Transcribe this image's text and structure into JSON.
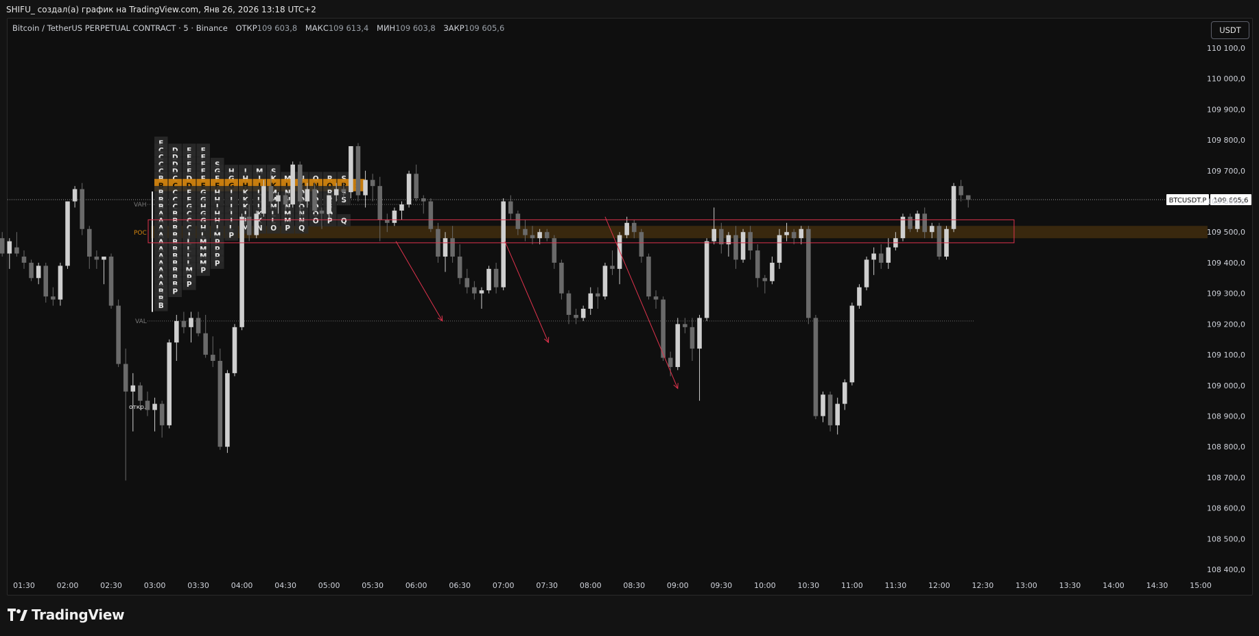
{
  "caption": "SHIFU_ создал(а) график на TradingView.com, Янв 26, 2026 13:18 UTC+2",
  "legend": {
    "symbol": "Bitcoin / TetherUS PERPETUAL CONTRACT · 5 · Binance",
    "open_label": "ОТКР",
    "open": "109 603,8",
    "high_label": "МАКС",
    "high": "109 613,4",
    "low_label": "МИН",
    "low": "109 603,8",
    "close_label": "ЗАКР",
    "close": "109 605,6"
  },
  "currency_button": "USDT",
  "brand": "TradingView",
  "chart_data": {
    "type": "candlestick",
    "symbol": "BTCUSDT.P",
    "interval": "5",
    "last_price_label": "BTCUSDT.P",
    "last_price_text": "109 605,6",
    "last_price": 109605.6,
    "ylim": [
      108390,
      110125
    ],
    "y_ticks": [
      110100,
      110000,
      109900,
      109800,
      109700,
      109600,
      109500,
      109400,
      109300,
      109200,
      109100,
      109000,
      108900,
      108800,
      108700,
      108600,
      108500,
      108400
    ],
    "y_tick_labels": [
      "110 100,0",
      "110 000,0",
      "109 900,0",
      "109 800,0",
      "109 700,0",
      "109 600,0",
      "109 500,0",
      "109 400,0",
      "109 300,0",
      "109 200,0",
      "109 100,0",
      "109 000,0",
      "108 900,0",
      "108 800,0",
      "108 700,0",
      "108 600,0",
      "108 500,0",
      "108 400,0"
    ],
    "x_tick_labels": [
      "01:30",
      "02:00",
      "02:30",
      "03:00",
      "03:30",
      "04:00",
      "04:30",
      "05:00",
      "05:30",
      "06:00",
      "06:30",
      "07:00",
      "07:30",
      "08:00",
      "08:30",
      "09:00",
      "09:30",
      "10:00",
      "10:30",
      "11:00",
      "11:30",
      "12:00",
      "12:30",
      "13:00",
      "13:30",
      "14:00",
      "14:30",
      "15:00"
    ],
    "x_tick_minutes": [
      90,
      120,
      150,
      180,
      210,
      240,
      270,
      300,
      330,
      360,
      390,
      420,
      450,
      480,
      510,
      540,
      570,
      600,
      630,
      660,
      690,
      720,
      750,
      780,
      810,
      840,
      870,
      900
    ],
    "xlim_minutes": [
      75,
      904
    ],
    "candles_start_minute": 75,
    "candles_interval_minutes": 5,
    "candles": [
      [
        109480,
        109500,
        109420,
        109430
      ],
      [
        109430,
        109480,
        109380,
        109470
      ],
      [
        109450,
        109500,
        109420,
        109430
      ],
      [
        109420,
        109440,
        109380,
        109400
      ],
      [
        109400,
        109410,
        109340,
        109350
      ],
      [
        109350,
        109400,
        109330,
        109390
      ],
      [
        109390,
        109400,
        109270,
        109290
      ],
      [
        109290,
        109320,
        109260,
        109280
      ],
      [
        109280,
        109400,
        109260,
        109390
      ],
      [
        109390,
        109600,
        109380,
        109600
      ],
      [
        109600,
        109650,
        109580,
        109640
      ],
      [
        109640,
        109660,
        109490,
        109510
      ],
      [
        109510,
        109520,
        109380,
        109420
      ],
      [
        109420,
        109440,
        109380,
        109410
      ],
      [
        109410,
        109420,
        109330,
        109420
      ],
      [
        109420,
        109430,
        109250,
        109260
      ],
      [
        109260,
        109280,
        109060,
        109070
      ],
      [
        109070,
        109120,
        108690,
        108980
      ],
      [
        108980,
        109040,
        108850,
        109000
      ],
      [
        109000,
        109010,
        108920,
        108950
      ],
      [
        108950,
        108980,
        108900,
        108920
      ],
      [
        108920,
        108960,
        108850,
        108940
      ],
      [
        108940,
        108950,
        108830,
        108870
      ],
      [
        108870,
        109150,
        108860,
        109140
      ],
      [
        109140,
        109230,
        109080,
        109210
      ],
      [
        109210,
        109240,
        109170,
        109190
      ],
      [
        109190,
        109240,
        109140,
        109220
      ],
      [
        109220,
        109240,
        109160,
        109170
      ],
      [
        109170,
        109230,
        109090,
        109100
      ],
      [
        109100,
        109160,
        109060,
        109080
      ],
      [
        109080,
        109120,
        108790,
        108800
      ],
      [
        108800,
        109050,
        108780,
        109040
      ],
      [
        109040,
        109200,
        109030,
        109190
      ],
      [
        109190,
        109560,
        109180,
        109550
      ],
      [
        109550,
        109590,
        109470,
        109490
      ],
      [
        109490,
        109570,
        109480,
        109560
      ],
      [
        109560,
        109670,
        109550,
        109650
      ],
      [
        109650,
        109700,
        109580,
        109600
      ],
      [
        109600,
        109630,
        109560,
        109620
      ],
      [
        109620,
        109630,
        109570,
        109590
      ],
      [
        109590,
        109730,
        109580,
        109720
      ],
      [
        109720,
        109730,
        109550,
        109600
      ],
      [
        109600,
        109660,
        109580,
        109640
      ],
      [
        109640,
        109660,
        109560,
        109570
      ],
      [
        109570,
        109580,
        109510,
        109560
      ],
      [
        109560,
        109620,
        109530,
        109620
      ],
      [
        109620,
        109660,
        109600,
        109640
      ],
      [
        109640,
        109660,
        109600,
        109630
      ],
      [
        109630,
        109780,
        109610,
        109780
      ],
      [
        109780,
        109790,
        109600,
        109620
      ],
      [
        109620,
        109700,
        109580,
        109670
      ],
      [
        109670,
        109690,
        109600,
        109650
      ],
      [
        109650,
        109680,
        109470,
        109540
      ],
      [
        109540,
        109560,
        109500,
        109530
      ],
      [
        109530,
        109580,
        109520,
        109570
      ],
      [
        109570,
        109600,
        109540,
        109590
      ],
      [
        109590,
        109700,
        109580,
        109690
      ],
      [
        109690,
        109720,
        109600,
        109610
      ],
      [
        109610,
        109620,
        109560,
        109600
      ],
      [
        109600,
        109610,
        109500,
        109510
      ],
      [
        109510,
        109530,
        109400,
        109420
      ],
      [
        109420,
        109500,
        109370,
        109480
      ],
      [
        109480,
        109520,
        109400,
        109420
      ],
      [
        109420,
        109460,
        109330,
        109350
      ],
      [
        109350,
        109380,
        109300,
        109320
      ],
      [
        109320,
        109340,
        109280,
        109300
      ],
      [
        109300,
        109320,
        109250,
        109310
      ],
      [
        109310,
        109390,
        109300,
        109380
      ],
      [
        109380,
        109400,
        109300,
        109320
      ],
      [
        109320,
        109610,
        109310,
        109600
      ],
      [
        109600,
        109620,
        109540,
        109560
      ],
      [
        109560,
        109570,
        109490,
        109510
      ],
      [
        109510,
        109540,
        109470,
        109490
      ],
      [
        109490,
        109520,
        109460,
        109480
      ],
      [
        109480,
        109510,
        109460,
        109500
      ],
      [
        109500,
        109510,
        109470,
        109480
      ],
      [
        109480,
        109490,
        109380,
        109400
      ],
      [
        109400,
        109410,
        109280,
        109300
      ],
      [
        109300,
        109310,
        109200,
        109230
      ],
      [
        109230,
        109250,
        109200,
        109220
      ],
      [
        109220,
        109260,
        109210,
        109250
      ],
      [
        109250,
        109320,
        109230,
        109300
      ],
      [
        109300,
        109320,
        109250,
        109290
      ],
      [
        109290,
        109400,
        109280,
        109390
      ],
      [
        109390,
        109440,
        109360,
        109380
      ],
      [
        109380,
        109500,
        109330,
        109490
      ],
      [
        109490,
        109550,
        109480,
        109530
      ],
      [
        109530,
        109540,
        109480,
        109500
      ],
      [
        109500,
        109510,
        109400,
        109420
      ],
      [
        109420,
        109430,
        109280,
        109290
      ],
      [
        109290,
        109310,
        109250,
        109280
      ],
      [
        109280,
        109290,
        109080,
        109090
      ],
      [
        109090,
        109110,
        109030,
        109060
      ],
      [
        109060,
        109220,
        109050,
        109200
      ],
      [
        109200,
        109220,
        109170,
        109190
      ],
      [
        109190,
        109220,
        109080,
        109120
      ],
      [
        109120,
        109230,
        108950,
        109220
      ],
      [
        109220,
        109480,
        109210,
        109470
      ],
      [
        109470,
        109580,
        109460,
        109510
      ],
      [
        109510,
        109530,
        109430,
        109460
      ],
      [
        109460,
        109500,
        109420,
        109490
      ],
      [
        109490,
        109520,
        109380,
        109410
      ],
      [
        109410,
        109510,
        109400,
        109500
      ],
      [
        109500,
        109520,
        109410,
        109440
      ],
      [
        109440,
        109460,
        109320,
        109350
      ],
      [
        109350,
        109360,
        109300,
        109340
      ],
      [
        109340,
        109420,
        109330,
        109400
      ],
      [
        109400,
        109510,
        109380,
        109490
      ],
      [
        109490,
        109530,
        109470,
        109500
      ],
      [
        109500,
        109510,
        109460,
        109480
      ],
      [
        109480,
        109520,
        109460,
        109510
      ],
      [
        109510,
        109520,
        109200,
        109220
      ],
      [
        109220,
        109230,
        108890,
        108900
      ],
      [
        108900,
        108980,
        108880,
        108970
      ],
      [
        108970,
        108980,
        108850,
        108870
      ],
      [
        108870,
        108960,
        108840,
        108940
      ],
      [
        108940,
        109020,
        108920,
        109010
      ],
      [
        109010,
        109270,
        109000,
        109260
      ],
      [
        109260,
        109330,
        109250,
        109320
      ],
      [
        109320,
        109420,
        109310,
        109410
      ],
      [
        109410,
        109450,
        109360,
        109430
      ],
      [
        109430,
        109460,
        109380,
        109400
      ],
      [
        109400,
        109480,
        109380,
        109450
      ],
      [
        109450,
        109500,
        109440,
        109480
      ],
      [
        109480,
        109560,
        109470,
        109550
      ],
      [
        109550,
        109560,
        109500,
        109510
      ],
      [
        109510,
        109570,
        109500,
        109560
      ],
      [
        109560,
        109580,
        109480,
        109500
      ],
      [
        109500,
        109530,
        109480,
        109520
      ],
      [
        109520,
        109530,
        109410,
        109420
      ],
      [
        109420,
        109520,
        109410,
        109510
      ],
      [
        109510,
        109660,
        109500,
        109650
      ],
      [
        109650,
        109670,
        109600,
        109620
      ],
      [
        109620,
        109610,
        109580,
        109606
      ]
    ],
    "tpo_profile": {
      "poc_label": "POC",
      "vah_label": "VAH",
      "val_label": "VAL",
      "open_marker_label": "откр.",
      "poc_price": 109500,
      "vah_price": 109590,
      "val_price": 109210,
      "row_start_price": 109790,
      "row_step": 23,
      "rows": [
        [
          "E"
        ],
        [
          "C",
          "D",
          "E",
          "F"
        ],
        [
          "C",
          "D",
          "E",
          "F"
        ],
        [
          "C",
          "D",
          "E",
          "F",
          "S"
        ],
        [
          "C",
          "D",
          "E",
          "F",
          "G",
          "H",
          "I",
          "M",
          "S"
        ],
        [
          "B",
          "C",
          "D",
          "E",
          "F",
          "G",
          "H",
          "I",
          "K",
          "M",
          "N",
          "O",
          "R",
          "S"
        ],
        [
          "B",
          "C",
          "D",
          "E",
          "F",
          "G",
          "H",
          "I",
          "K",
          "L",
          "M",
          "N",
          "O",
          "R",
          "S"
        ],
        [
          "B",
          "C",
          "F",
          "G",
          "H",
          "I",
          "K",
          "L",
          "M",
          "N",
          "O",
          "Q",
          "R",
          "S"
        ],
        [
          "B",
          "C",
          "F",
          "G",
          "H",
          "I",
          "K",
          "L",
          "M",
          "N",
          "O",
          "Q",
          "R",
          "S"
        ],
        [
          "B",
          "C",
          "G",
          "H",
          "I",
          "J",
          "K",
          "L",
          "M",
          "N",
          "O",
          "Q",
          "S"
        ],
        [
          "A",
          "B",
          "C",
          "G",
          "H",
          "I",
          "J",
          "K",
          "L",
          "M",
          "N",
          "O",
          "Q"
        ],
        [
          "A",
          "B",
          "C",
          "G",
          "H",
          "I",
          "J",
          "K",
          "L",
          "M",
          "N",
          "O",
          "P",
          "Q"
        ],
        [
          "A",
          "B",
          "C",
          "H",
          "J",
          "L",
          "M",
          "N",
          "O",
          "P",
          "Q"
        ],
        [
          "A",
          "B",
          "J",
          "L",
          "M",
          "P"
        ],
        [
          "A",
          "B",
          "L",
          "M",
          "P"
        ],
        [
          "A",
          "B",
          "L",
          "M",
          "P"
        ],
        [
          "A",
          "B",
          "L",
          "M",
          "P"
        ],
        [
          "A",
          "B",
          "L",
          "M",
          "P"
        ],
        [
          "A",
          "B",
          "M",
          "P"
        ],
        [
          "A",
          "B",
          "P"
        ],
        [
          "A",
          "B",
          "P"
        ],
        [
          "B",
          "P"
        ],
        [
          "B"
        ],
        [
          "B"
        ]
      ],
      "poc_row_index": 6
    },
    "value_area_box": {
      "from_minute": 180,
      "to_minute": 760,
      "top_price": 109540,
      "bottom_price": 109465
    },
    "arrows": [
      {
        "from_minute": 346,
        "from_price": 109470,
        "to_minute": 378,
        "to_price": 109210
      },
      {
        "from_minute": 421,
        "from_price": 109470,
        "to_minute": 451,
        "to_price": 109140
      },
      {
        "from_minute": 490,
        "from_price": 109550,
        "to_minute": 540,
        "to_price": 108990
      }
    ],
    "colors": {
      "background": "#0f0f0f",
      "candle_up": "#cfcfcf",
      "candle_down": "#6a6a6a",
      "poc": "#d0820e",
      "tpo_cell": "#2b2b2b",
      "tpo_text": "#e6e6e6",
      "box": "#e0334d",
      "arrow": "#e0334d",
      "price_line": "#9a9a9a",
      "axis_text": "#d1d4dc"
    }
  }
}
